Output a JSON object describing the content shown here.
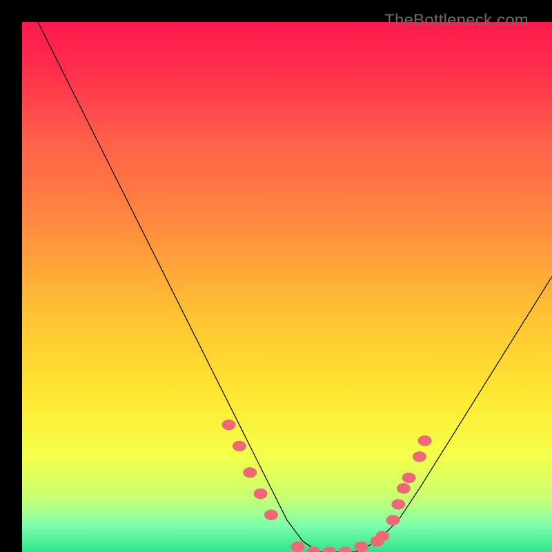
{
  "watermark": "TheBottleneck.com",
  "chart_data": {
    "type": "line",
    "title": "",
    "xlabel": "",
    "ylabel": "",
    "xlim": [
      0,
      100
    ],
    "ylim": [
      0,
      100
    ],
    "grid": false,
    "series": [
      {
        "name": "curve",
        "x": [
          3,
          7,
          12,
          17,
          22,
          27,
          32,
          36,
          40,
          44,
          47,
          50,
          53,
          56,
          60,
          63,
          67,
          71,
          75,
          80,
          85,
          90,
          95,
          100
        ],
        "y": [
          100,
          92,
          82,
          72,
          62,
          52,
          42,
          34,
          26,
          18,
          12,
          6,
          2,
          0,
          0,
          0,
          2,
          6,
          12,
          20,
          28,
          36,
          44,
          52
        ]
      }
    ],
    "markers": [
      {
        "name": "dot",
        "x": 39,
        "y": 24
      },
      {
        "name": "dot",
        "x": 41,
        "y": 20
      },
      {
        "name": "dot",
        "x": 43,
        "y": 15
      },
      {
        "name": "dot",
        "x": 45,
        "y": 11
      },
      {
        "name": "dot",
        "x": 47,
        "y": 7
      },
      {
        "name": "dot",
        "x": 52,
        "y": 1
      },
      {
        "name": "dot",
        "x": 55,
        "y": 0
      },
      {
        "name": "dot",
        "x": 58,
        "y": 0
      },
      {
        "name": "dot",
        "x": 61,
        "y": 0
      },
      {
        "name": "dot",
        "x": 64,
        "y": 1
      },
      {
        "name": "dot",
        "x": 67,
        "y": 2
      },
      {
        "name": "dot",
        "x": 68,
        "y": 3
      },
      {
        "name": "dot",
        "x": 70,
        "y": 6
      },
      {
        "name": "dot",
        "x": 71,
        "y": 9
      },
      {
        "name": "dot",
        "x": 72,
        "y": 12
      },
      {
        "name": "dot",
        "x": 73,
        "y": 14
      },
      {
        "name": "dot",
        "x": 75,
        "y": 18
      },
      {
        "name": "dot",
        "x": 76,
        "y": 21
      }
    ],
    "background_gradient": {
      "type": "vertical",
      "stops": [
        {
          "offset": 0,
          "color": "#ff1a4d"
        },
        {
          "offset": 0.08,
          "color": "#ff2b4d"
        },
        {
          "offset": 0.22,
          "color": "#ff5e4a"
        },
        {
          "offset": 0.38,
          "color": "#ff8a3f"
        },
        {
          "offset": 0.55,
          "color": "#ffc233"
        },
        {
          "offset": 0.7,
          "color": "#ffe731"
        },
        {
          "offset": 0.82,
          "color": "#f4ff4a"
        },
        {
          "offset": 0.9,
          "color": "#c6ff73"
        },
        {
          "offset": 0.95,
          "color": "#7dffad"
        },
        {
          "offset": 1.0,
          "color": "#30e38b"
        }
      ]
    },
    "marker_color": "#ed6a75",
    "curve_color": "#000000"
  }
}
